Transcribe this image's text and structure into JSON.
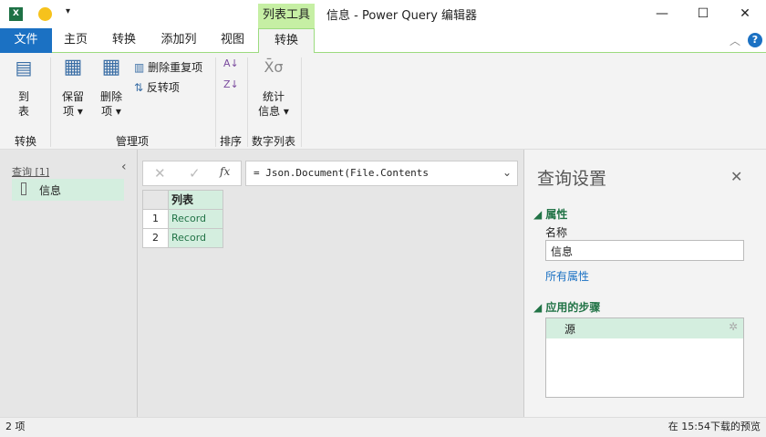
{
  "window": {
    "title": "信息 - Power Query 编辑器",
    "context_tab_group": "列表工具"
  },
  "tabs": [
    "文件",
    "主页",
    "转换",
    "添加列",
    "视图",
    "转换"
  ],
  "ribbon": {
    "to_table": {
      "line1": "到",
      "line2": "表"
    },
    "keep": {
      "line1": "保留",
      "line2": "项"
    },
    "remove": {
      "line1": "删除",
      "line2": "项"
    },
    "remove_duplicates": "删除重复项",
    "reverse": "反转项",
    "stats": {
      "line1": "统计",
      "line2": "信息"
    },
    "groups": [
      "转换",
      "管理项",
      "排序",
      "数字列表"
    ]
  },
  "queries": {
    "header": "查询 [1]",
    "items": [
      "信息"
    ]
  },
  "formula": {
    "text": "= Json.Document(File.Contents",
    "fx": "fx"
  },
  "table": {
    "column": "列表",
    "rows": [
      {
        "n": "1",
        "v": "Record"
      },
      {
        "n": "2",
        "v": "Record"
      }
    ]
  },
  "settings": {
    "title": "查询设置",
    "properties": "属性",
    "name_label": "名称",
    "name_value": "信息",
    "all_properties": "所有属性",
    "applied_steps": "应用的步骤",
    "steps": [
      "源"
    ]
  },
  "status": {
    "left": "2 项",
    "right": "在 15:54下载的预览"
  },
  "colors": {
    "accent": "#1b71c3",
    "context": "#c6efa4",
    "selection": "#d4eedf",
    "link": "#1b71c3",
    "heading": "#217346"
  }
}
